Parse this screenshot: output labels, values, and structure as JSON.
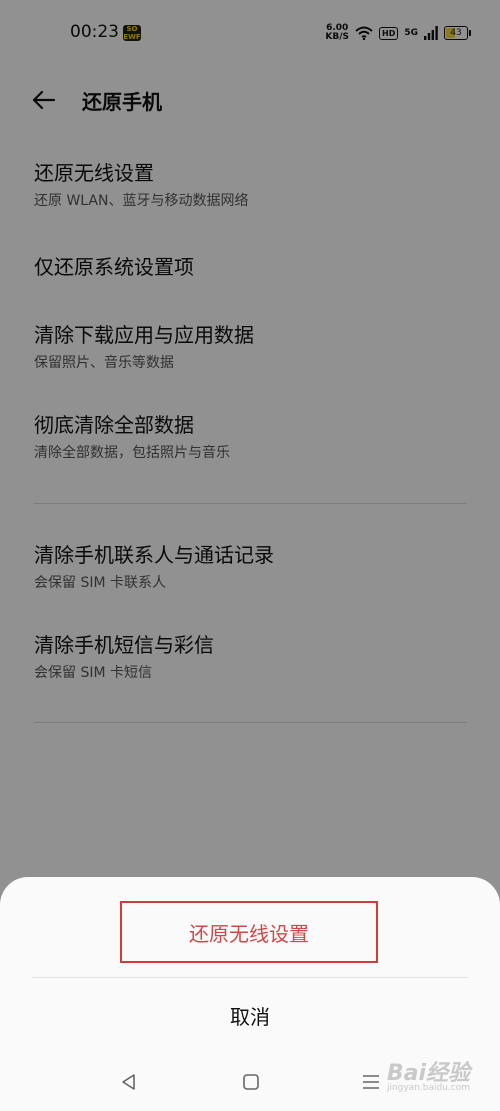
{
  "status_bar": {
    "time": "00:23",
    "app_badge": "SO EWF",
    "network_speed_value": "6.00",
    "network_speed_unit": "KB/S",
    "hd_label": "HD",
    "signal_label": "5G",
    "battery_level": "43"
  },
  "header": {
    "title": "还原手机"
  },
  "items": [
    {
      "title": "还原无线设置",
      "subtitle": "还原 WLAN、蓝牙与移动数据网络"
    },
    {
      "title": "仅还原系统设置项",
      "subtitle": ""
    },
    {
      "title": "清除下载应用与应用数据",
      "subtitle": "保留照片、音乐等数据"
    },
    {
      "title": "彻底清除全部数据",
      "subtitle": "清除全部数据，包括照片与音乐"
    },
    {
      "title": "清除手机联系人与通话记录",
      "subtitle": "会保留 SIM 卡联系人"
    },
    {
      "title": "清除手机短信与彩信",
      "subtitle": "会保留 SIM 卡短信"
    }
  ],
  "sheet": {
    "confirm_label": "还原无线设置",
    "cancel_label": "取消"
  },
  "watermark": {
    "text": "Bai经验",
    "sub": "jingyan.baidu.com"
  },
  "colors": {
    "accent": "#d04848",
    "highlight_border": "#d23b3b",
    "battery_fill": "#f0d040"
  }
}
